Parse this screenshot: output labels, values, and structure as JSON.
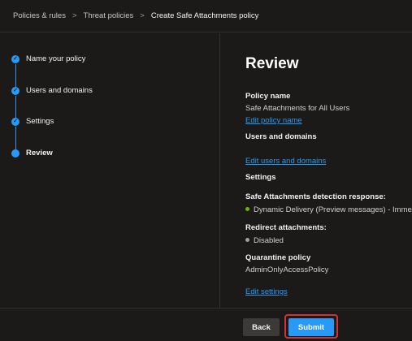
{
  "breadcrumb": {
    "items": [
      "Policies & rules",
      "Threat policies",
      "Create Safe Attachments policy"
    ],
    "separator": ">"
  },
  "steps": [
    {
      "label": "Name your policy",
      "status": "completed",
      "icon": "check-icon"
    },
    {
      "label": "Users and domains",
      "status": "completed",
      "icon": "check-icon"
    },
    {
      "label": "Settings",
      "status": "completed",
      "icon": "check-icon"
    },
    {
      "label": "Review",
      "status": "current",
      "icon": "dot-icon"
    }
  ],
  "check_glyph": "✓",
  "review": {
    "title": "Review",
    "policy_name_heading": "Policy name",
    "policy_name_value": "Safe Attachments for All Users",
    "edit_policy_name": "Edit policy name",
    "users_heading": "Users and domains",
    "edit_users": "Edit users and domains",
    "settings_heading": "Settings",
    "detection_heading": "Safe Attachments detection response:",
    "detection_value": "Dynamic Delivery (Preview messages) - Immediate",
    "redirect_heading": "Redirect attachments:",
    "redirect_value": "Disabled",
    "quarantine_heading": "Quarantine policy",
    "quarantine_value": "AdminOnlyAccessPolicy",
    "edit_settings": "Edit settings"
  },
  "footer": {
    "back_label": "Back",
    "submit_label": "Submit"
  },
  "colors": {
    "accent": "#2899f5",
    "enabled_status": "#6bb700",
    "disabled_status": "#a19f9d",
    "highlight": "#d13438",
    "background": "#1b1a19"
  }
}
